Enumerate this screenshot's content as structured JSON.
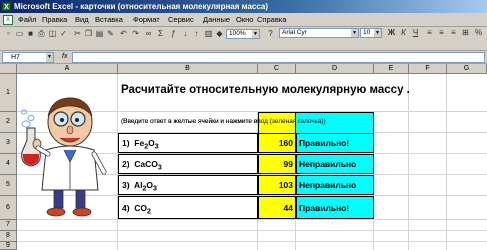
{
  "window": {
    "title": "Microsoft Excel - карточки (относительная молекулярная масса)",
    "app_icon": "excel-icon"
  },
  "menu": [
    {
      "label": "Файл"
    },
    {
      "label": "Правка"
    },
    {
      "label": "Вид"
    },
    {
      "label": "Вставка"
    },
    {
      "label": "Формат"
    },
    {
      "label": "Сервис"
    },
    {
      "label": "Данные"
    },
    {
      "label": "Окно"
    },
    {
      "label": "Справка"
    }
  ],
  "toolbar": {
    "font_name": "Arial Cyr",
    "font_size": "10",
    "zoom": "100%",
    "bold": "Ж",
    "italic": "К",
    "underline": "Ч",
    "help": "?"
  },
  "formula_bar": {
    "cell_ref": "H7",
    "fx": "fx",
    "content": ""
  },
  "columns": [
    "A",
    "B",
    "C",
    "D",
    "E",
    "F",
    "G"
  ],
  "rows": [
    "1",
    "2",
    "3",
    "4",
    "5",
    "6",
    "7",
    "8",
    "9"
  ],
  "sheet": {
    "heading": "Расчитайте относительную молекулярную массу .",
    "instruction": "(Введите ответ в желтые ячейки и нажмите ввод (зеленая галочка))",
    "items": [
      {
        "num": "1)",
        "base": "Fe",
        "sub1": "2",
        "mid": "O",
        "sub2": "3",
        "answer": "160",
        "result": "Правильно!"
      },
      {
        "num": "2)",
        "base": "CaCO",
        "sub1": "3",
        "mid": "",
        "sub2": "",
        "answer": "99",
        "result": "Неправильно"
      },
      {
        "num": "3)",
        "base": "Al",
        "sub1": "2",
        "mid": "O",
        "sub2": "3",
        "answer": "103",
        "result": "Неправильно"
      },
      {
        "num": "4)",
        "base": "CO",
        "sub1": "2",
        "mid": "",
        "sub2": "",
        "answer": "44",
        "result": "Правильно!"
      }
    ]
  },
  "colors": {
    "answer_cell": "#ffff00",
    "result_cell": "#00ffff",
    "title_bar": "#0a246a"
  }
}
